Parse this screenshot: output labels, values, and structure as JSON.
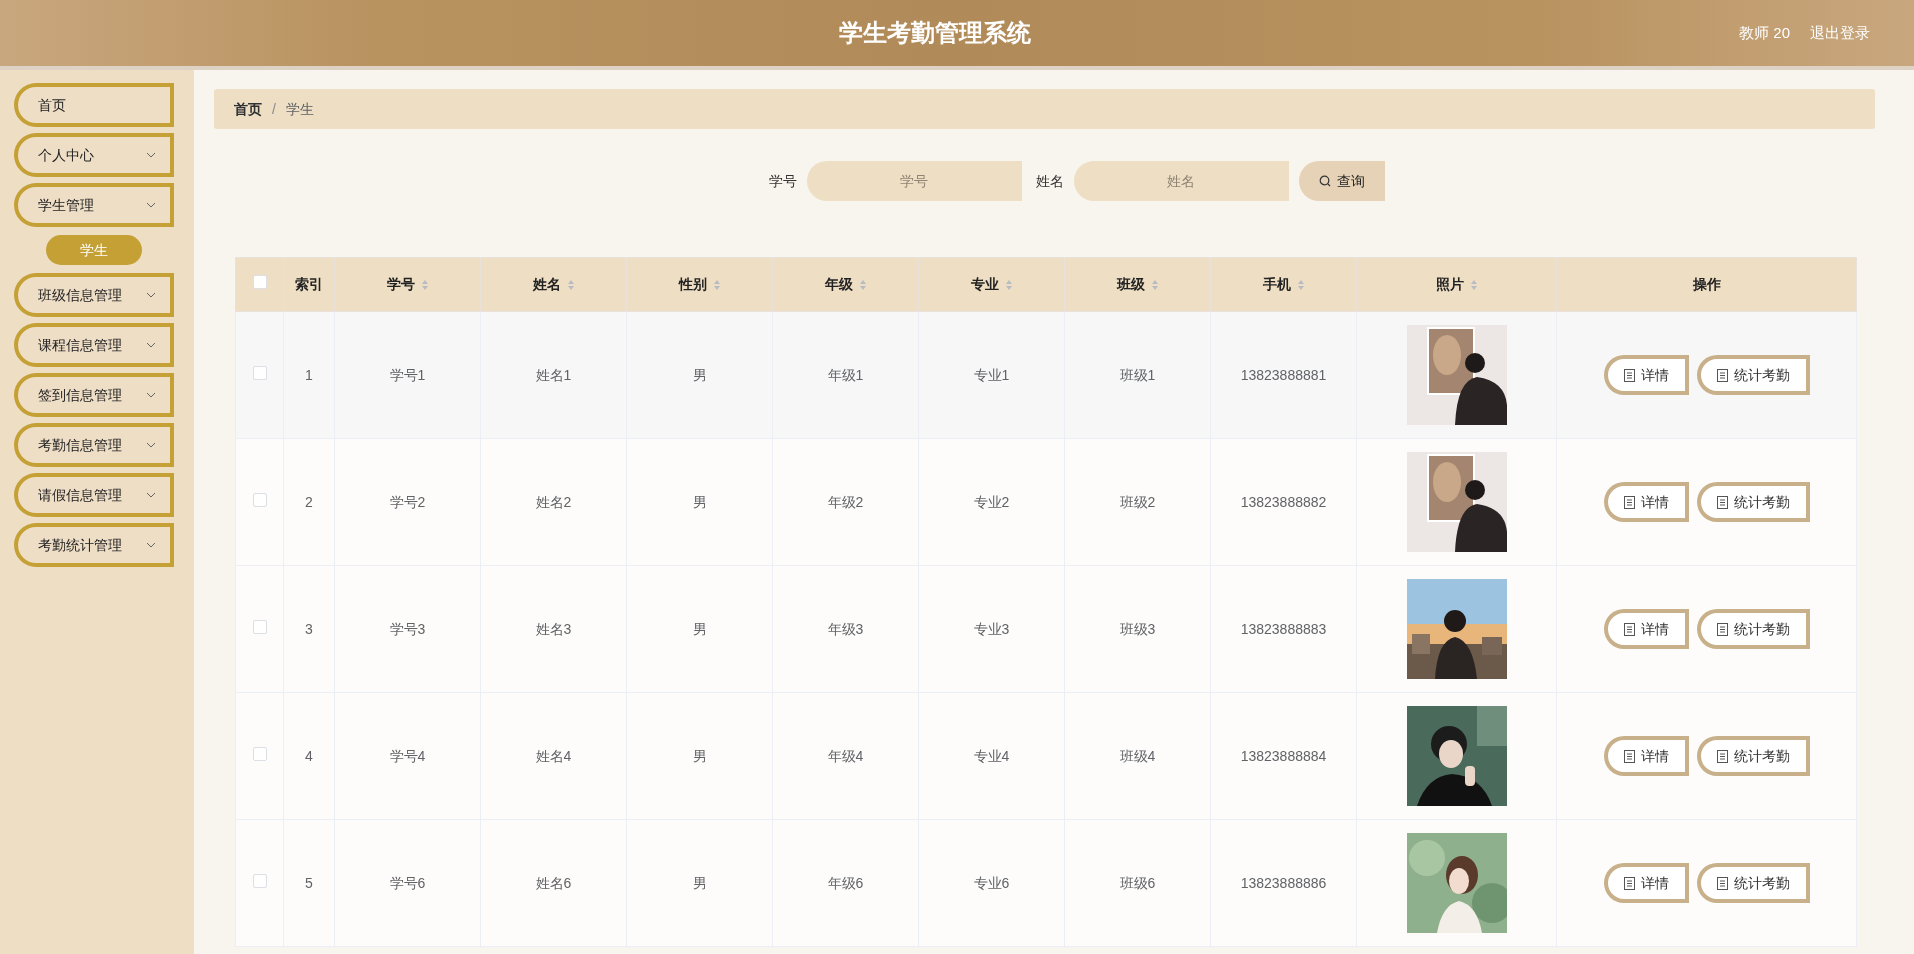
{
  "header": {
    "title": "学生考勤管理系统",
    "user": "教师 20",
    "logout": "退出登录"
  },
  "sidebar": {
    "items": [
      {
        "label": "首页",
        "kind": "link"
      },
      {
        "label": "个人中心",
        "kind": "menu"
      },
      {
        "label": "学生管理",
        "kind": "menu",
        "children": [
          {
            "label": "学生",
            "selected": true
          }
        ]
      },
      {
        "label": "班级信息管理",
        "kind": "menu"
      },
      {
        "label": "课程信息管理",
        "kind": "menu"
      },
      {
        "label": "签到信息管理",
        "kind": "menu"
      },
      {
        "label": "考勤信息管理",
        "kind": "menu"
      },
      {
        "label": "请假信息管理",
        "kind": "menu"
      },
      {
        "label": "考勤统计管理",
        "kind": "menu"
      }
    ]
  },
  "breadcrumb": {
    "separator": "/",
    "items": [
      "首页",
      "学生"
    ]
  },
  "search": {
    "fields": [
      {
        "label": "学号",
        "placeholder": "学号"
      },
      {
        "label": "姓名",
        "placeholder": "姓名"
      }
    ],
    "button": "查询"
  },
  "table": {
    "select_all": {
      "checked": false
    },
    "columns": [
      {
        "label": "索引",
        "sortable": false
      },
      {
        "label": "学号",
        "sortable": true
      },
      {
        "label": "姓名",
        "sortable": true
      },
      {
        "label": "性别",
        "sortable": true
      },
      {
        "label": "年级",
        "sortable": true
      },
      {
        "label": "专业",
        "sortable": true
      },
      {
        "label": "班级",
        "sortable": true
      },
      {
        "label": "手机",
        "sortable": true
      },
      {
        "label": "照片",
        "sortable": true
      },
      {
        "label": "操作",
        "sortable": false
      }
    ],
    "rows": [
      {
        "checked": false,
        "cells": [
          "1",
          "学号1",
          "姓名1",
          "男",
          "年级1",
          "专业1",
          "班级1",
          "13823888881"
        ],
        "photo": {
          "kind": "picture"
        },
        "actions": [
          "详情",
          "统计考勤"
        ]
      },
      {
        "checked": false,
        "cells": [
          "2",
          "学号2",
          "姓名2",
          "男",
          "年级2",
          "专业2",
          "班级2",
          "13823888882"
        ],
        "photo": {
          "kind": "picture"
        },
        "actions": [
          "详情",
          "统计考勤"
        ]
      },
      {
        "checked": false,
        "cells": [
          "3",
          "学号3",
          "姓名3",
          "男",
          "年级3",
          "专业3",
          "班级3",
          "13823888883"
        ],
        "photo": {
          "kind": "picture"
        },
        "actions": [
          "详情",
          "统计考勤"
        ]
      },
      {
        "checked": false,
        "cells": [
          "4",
          "学号4",
          "姓名4",
          "男",
          "年级4",
          "专业4",
          "班级4",
          "13823888884"
        ],
        "photo": {
          "kind": "picture"
        },
        "actions": [
          "详情",
          "统计考勤"
        ]
      },
      {
        "checked": false,
        "cells": [
          "5",
          "学号6",
          "姓名6",
          "男",
          "年级6",
          "专业6",
          "班级6",
          "13823888886"
        ],
        "photo": {
          "kind": "picture"
        },
        "actions": [
          "详情",
          "统计考勤"
        ]
      }
    ]
  }
}
